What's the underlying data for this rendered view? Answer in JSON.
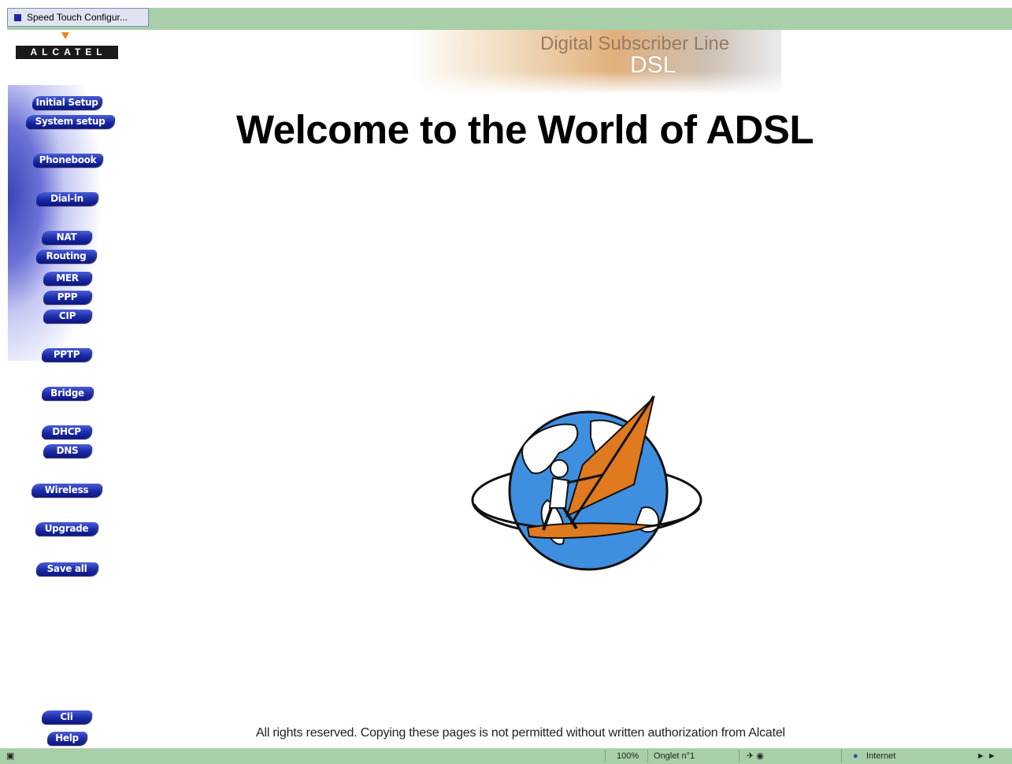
{
  "tab": {
    "title": "Speed Touch Configur..."
  },
  "logo": {
    "text": "ALCATEL"
  },
  "banner": {
    "title": "Digital Subscriber Line",
    "subtitle": "DSL"
  },
  "main": {
    "heading": "Welcome to the World of ADSL",
    "footer": "All rights reserved. Copying these pages is not permitted without written authorization from Alcatel"
  },
  "nav": {
    "initial_setup": "Initial Setup",
    "system_setup": "System setup",
    "phonebook": "Phonebook",
    "dial_in": "Dial-in",
    "nat": "NAT",
    "routing": "Routing",
    "mer": "MER",
    "ppp": "PPP",
    "cip": "CIP",
    "pptp": "PPTP",
    "bridge": "Bridge",
    "dhcp": "DHCP",
    "dns": "DNS",
    "wireless": "Wireless",
    "upgrade": "Upgrade",
    "save_all": "Save all",
    "cli": "Cli",
    "help": "Help"
  },
  "statusbar": {
    "zoom": "100%",
    "tab_label": "Onglet n°1",
    "zone": "Internet",
    "zone_icon": "globe-icon"
  }
}
